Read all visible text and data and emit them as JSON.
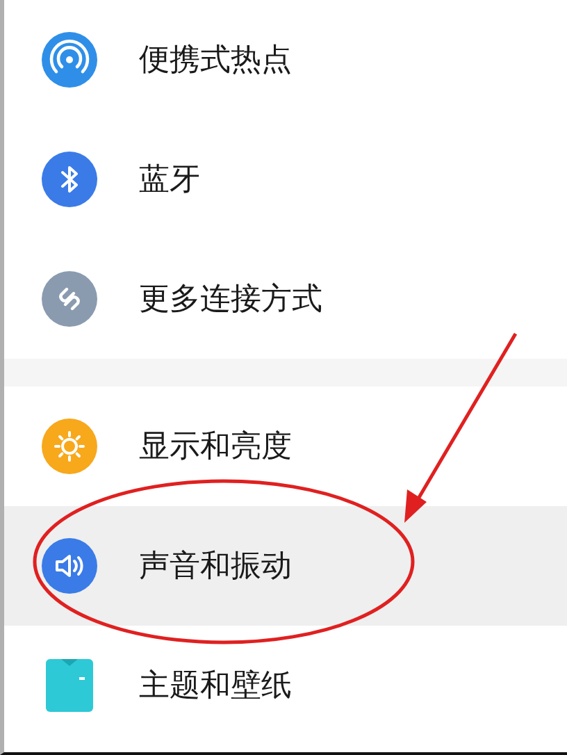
{
  "groups": [
    {
      "items": [
        {
          "label": "便携式热点",
          "selected": false
        },
        {
          "label": "蓝牙",
          "selected": false
        },
        {
          "label": "更多连接方式",
          "selected": false
        }
      ]
    },
    {
      "items": [
        {
          "label": "显示和亮度",
          "selected": false
        },
        {
          "label": "声音和振动",
          "selected": true
        },
        {
          "label": "主题和壁纸",
          "selected": false
        }
      ]
    }
  ]
}
